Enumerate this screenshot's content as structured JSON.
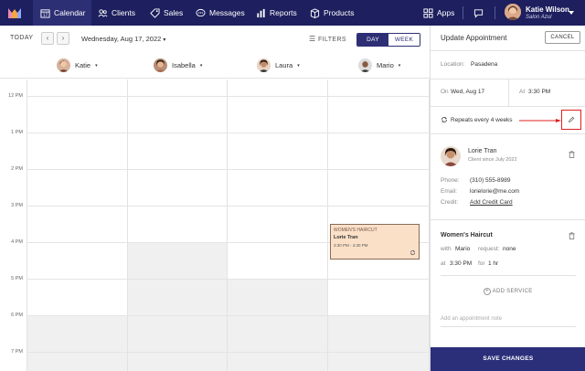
{
  "nav": {
    "items": [
      {
        "label": "Calendar",
        "icon": "calendar-icon",
        "active": true
      },
      {
        "label": "Clients",
        "icon": "users-icon"
      },
      {
        "label": "Sales",
        "icon": "tag-icon"
      },
      {
        "label": "Messages",
        "icon": "chat-icon"
      },
      {
        "label": "Reports",
        "icon": "bar-chart-icon"
      },
      {
        "label": "Products",
        "icon": "box-icon"
      }
    ],
    "apps_label": "Apps",
    "user_name": "Katie Wilson",
    "user_business": "Salon Azul"
  },
  "calendar": {
    "today_label": "TODAY",
    "date_label": "Wednesday, Aug 17, 2022",
    "filters_label": "FILTERS",
    "view_day": "DAY",
    "view_week": "WEEK",
    "staff": [
      "Katie",
      "Isabella",
      "Laura",
      "Mario"
    ],
    "times": [
      "12 PM",
      "1 PM",
      "2 PM",
      "3 PM",
      "4 PM",
      "5 PM",
      "6 PM",
      "7 PM"
    ],
    "appointment": {
      "service": "WOMEN'S HAIRCUT",
      "client": "Lorie Tran",
      "time": "3:30 PM - 4:30 PM"
    }
  },
  "panel": {
    "title": "Update Appointment",
    "cancel_label": "CANCEL",
    "location_label": "Location:",
    "location_value": "Pasadena",
    "on_label": "On",
    "date_value": "Wed, Aug 17",
    "at_label": "At",
    "time_value": "3:30 PM",
    "repeat_text": "Repeats every 4 weeks",
    "client": {
      "name": "Lorie Tran",
      "since": "Client since July 2022",
      "phone_label": "Phone:",
      "phone": "(310) 555-8989",
      "email_label": "Email:",
      "email": "lorielorie@me.com",
      "credit_label": "Credit:",
      "credit_link": "Add Credit Card"
    },
    "service": {
      "name": "Women's Haircut",
      "with_label": "with",
      "staff": "Mario",
      "request_label": "request:",
      "request_value": "none",
      "at_label": "at",
      "time": "3:30 PM",
      "for_label": "for",
      "duration": "1 hr"
    },
    "add_service_label": "ADD SERVICE",
    "note_placeholder": "Add an appointment note",
    "save_label": "SAVE CHANGES"
  }
}
